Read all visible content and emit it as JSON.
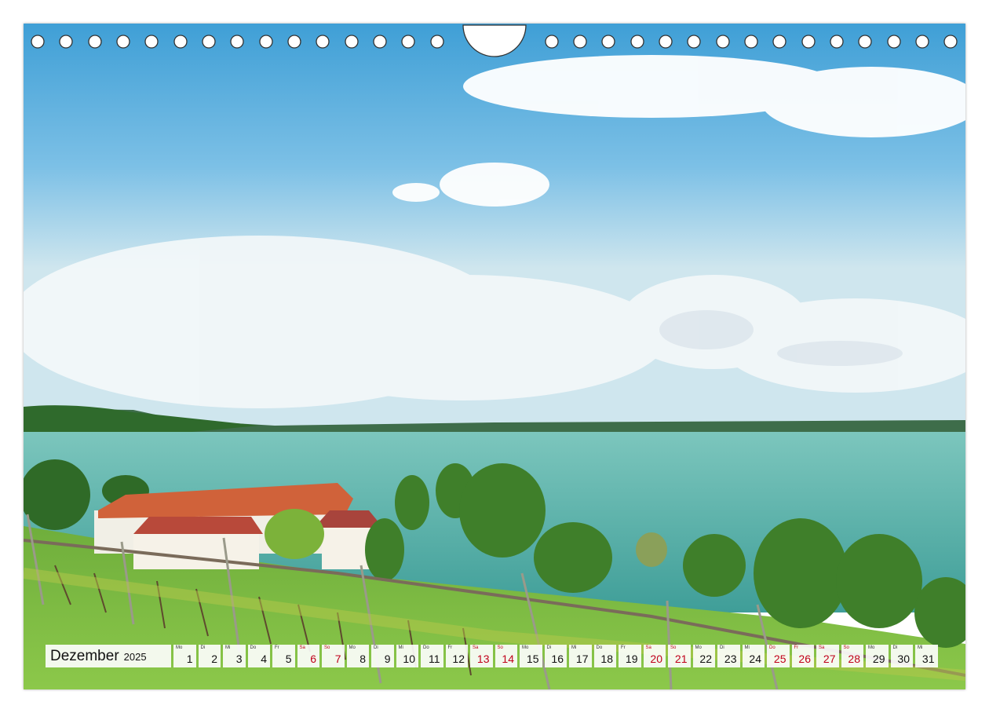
{
  "calendar": {
    "month": "Dezember",
    "year": "2025",
    "days": [
      {
        "dow": "Mo",
        "num": "1",
        "weekend": false
      },
      {
        "dow": "Di",
        "num": "2",
        "weekend": false
      },
      {
        "dow": "Mi",
        "num": "3",
        "weekend": false
      },
      {
        "dow": "Do",
        "num": "4",
        "weekend": false
      },
      {
        "dow": "Fr",
        "num": "5",
        "weekend": false
      },
      {
        "dow": "Sa",
        "num": "6",
        "weekend": true
      },
      {
        "dow": "So",
        "num": "7",
        "weekend": true
      },
      {
        "dow": "Mo",
        "num": "8",
        "weekend": false
      },
      {
        "dow": "Di",
        "num": "9",
        "weekend": false
      },
      {
        "dow": "Mi",
        "num": "10",
        "weekend": false
      },
      {
        "dow": "Do",
        "num": "11",
        "weekend": false
      },
      {
        "dow": "Fr",
        "num": "12",
        "weekend": false
      },
      {
        "dow": "Sa",
        "num": "13",
        "weekend": true
      },
      {
        "dow": "So",
        "num": "14",
        "weekend": true
      },
      {
        "dow": "Mo",
        "num": "15",
        "weekend": false
      },
      {
        "dow": "Di",
        "num": "16",
        "weekend": false
      },
      {
        "dow": "Mi",
        "num": "17",
        "weekend": false
      },
      {
        "dow": "Do",
        "num": "18",
        "weekend": false
      },
      {
        "dow": "Fr",
        "num": "19",
        "weekend": false
      },
      {
        "dow": "Sa",
        "num": "20",
        "weekend": true
      },
      {
        "dow": "So",
        "num": "21",
        "weekend": true
      },
      {
        "dow": "Mo",
        "num": "22",
        "weekend": false
      },
      {
        "dow": "Di",
        "num": "23",
        "weekend": false
      },
      {
        "dow": "Mi",
        "num": "24",
        "weekend": false
      },
      {
        "dow": "Do",
        "num": "25",
        "weekend": true
      },
      {
        "dow": "Fr",
        "num": "26",
        "weekend": true
      },
      {
        "dow": "Sa",
        "num": "27",
        "weekend": true
      },
      {
        "dow": "So",
        "num": "28",
        "weekend": true
      },
      {
        "dow": "Mo",
        "num": "29",
        "weekend": false
      },
      {
        "dow": "Di",
        "num": "30",
        "weekend": false
      },
      {
        "dow": "Mi",
        "num": "31",
        "weekend": false
      }
    ]
  },
  "colors": {
    "weekend_text": "#c0001a",
    "weekday_text": "#111111",
    "sky_top": "#3f9fd6",
    "lake": "#5fb3a8"
  }
}
